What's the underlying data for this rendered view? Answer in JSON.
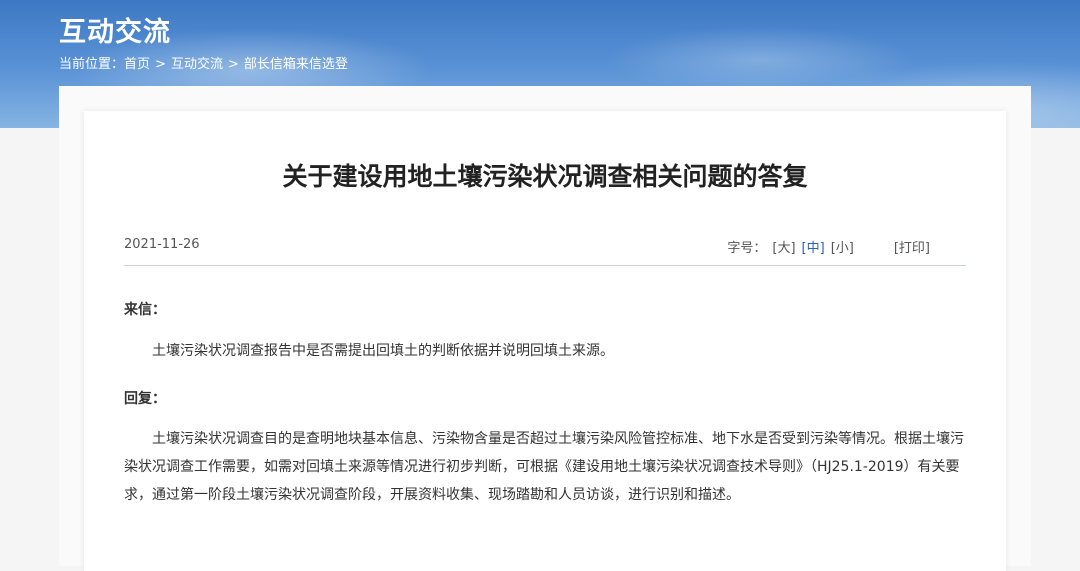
{
  "header": {
    "title": "互动交流",
    "breadcrumb": {
      "prefix": "当前位置：",
      "items": [
        "首页",
        "互动交流",
        "部长信箱来信选登"
      ],
      "separator": ">"
    }
  },
  "article": {
    "title": "关于建设用地土壤污染状况调查相关问题的答复",
    "date": "2021-11-26",
    "font_size_label": "字号：",
    "font_size_options": [
      "[大]",
      "[中]",
      "[小]"
    ],
    "active_font_size": "[中]",
    "print_label": "[打印]",
    "letter_label": "来信：",
    "letter_text": "土壤污染状况调查报告中是否需提出回填土的判断依据并说明回填土来源。",
    "reply_label": "回复：",
    "reply_text": "土壤污染状况调查目的是查明地块基本信息、污染物含量是否超过土壤污染风险管控标准、地下水是否受到污染等情况。根据土壤污染状况调查工作需要，如需对回填土来源等情况进行初步判断，可根据《建设用地土壤污染状况调查技术导则》（HJ25.1-2019）有关要求，通过第一阶段土壤污染状况调查阶段，开展资料收集、现场踏勘和人员访谈，进行识别和描述。"
  },
  "colors": {
    "banner": "#3d78c4",
    "accent_link": "#2a63b5",
    "divider": "#c9d4e6"
  }
}
